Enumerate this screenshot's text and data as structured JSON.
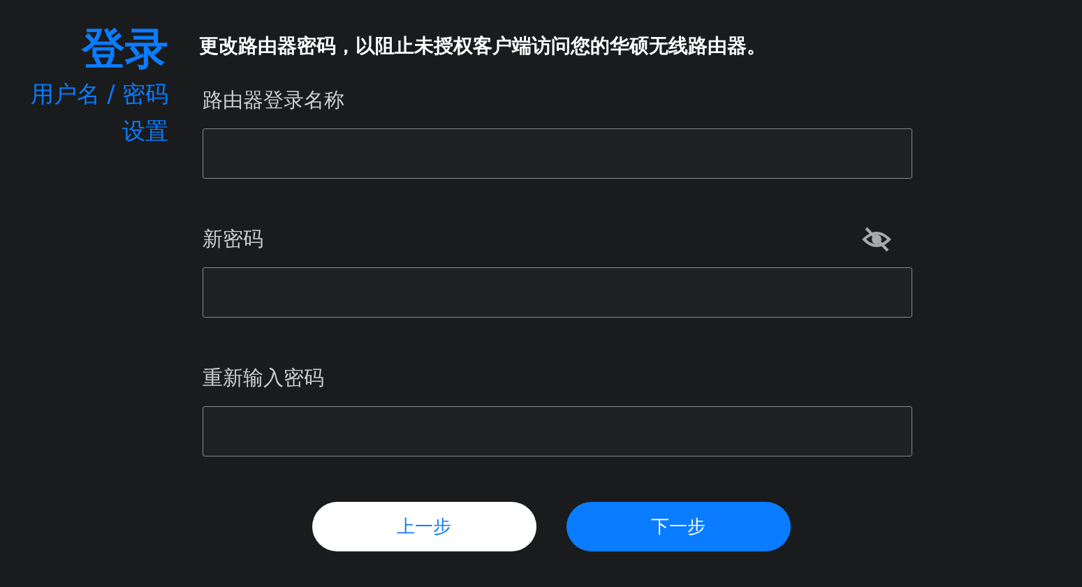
{
  "sidebar": {
    "title": "登录",
    "subtitle_lines": [
      "用户名 / 密码",
      "设置"
    ]
  },
  "heading": "更改路由器密码，以阻止未授权客户端访问您的华硕无线路由器。",
  "fields": [
    {
      "label": "路由器登录名称",
      "kind": "text"
    },
    {
      "label": "新密码",
      "kind": "password",
      "password_visible": false
    },
    {
      "label": "重新输入密码",
      "kind": "confirm"
    }
  ],
  "buttons": [
    {
      "label": "上一步",
      "kind": "secondary"
    },
    {
      "label": "下一步",
      "kind": "primary"
    }
  ]
}
